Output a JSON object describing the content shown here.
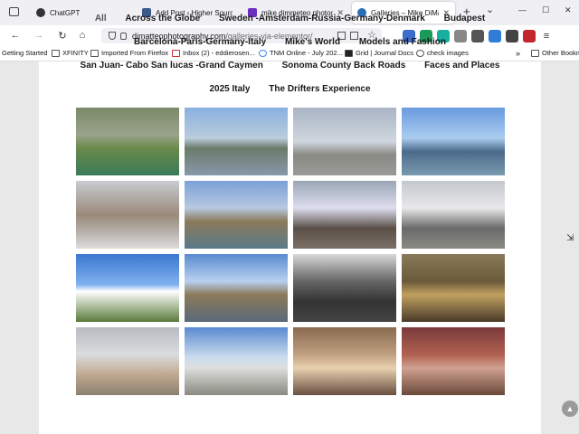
{
  "tabs": [
    {
      "label": "ChatGPT",
      "color": "#333333"
    },
    {
      "label": "Add Post ‹ Higher Source ‹",
      "color": "#3a5a8a"
    },
    {
      "label": "mike dimmeteo photograp",
      "color": "#6b2fbf"
    },
    {
      "label": "Galleries – Mike DiMatteo",
      "color": "#2a6fb5"
    }
  ],
  "tabbar": {
    "new_tab": "+",
    "list": "⌄",
    "minimize": "—",
    "maximize": "☐",
    "close": "✕"
  },
  "nav": {
    "back": "←",
    "forward": "→",
    "reload": "↻",
    "home": "⌂"
  },
  "url": {
    "host": "dimatteophotography.com",
    "path": "/galleries-via-elementor/"
  },
  "bookmarks": [
    "Getting Started",
    "XFINITY",
    "Imported From Firefox",
    "Inbox (2) - eddierosen...",
    "TNM Online - July 202...",
    "Grid | Journal Docs",
    "check images",
    "Other Bookm"
  ],
  "filters": [
    "All",
    "Across the Globe",
    "Sweden -Amsterdam-Russia-Germany-Denmark",
    "Budapest",
    "Barcelona-Paris-Germany-Italy",
    "Mike's World",
    "Models and Fashion",
    "San Juan- Cabo San lucas -Grand Caymen",
    "Sonoma County Back Roads",
    "Faces and Places",
    "2025 Italy",
    "The Drifters Experience"
  ],
  "colors": {
    "accent": "#2a6fb5"
  }
}
